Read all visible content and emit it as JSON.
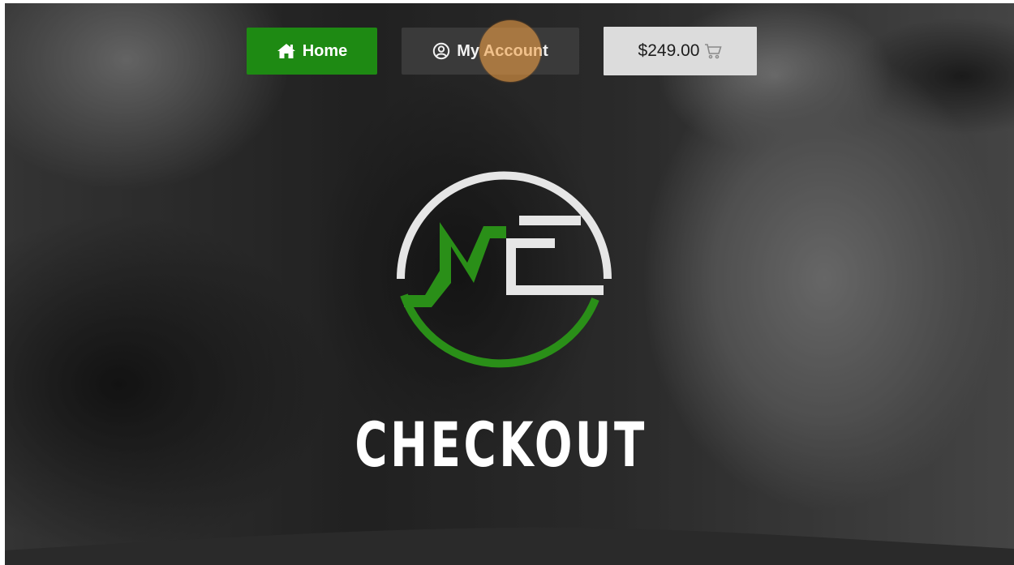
{
  "nav": {
    "home": {
      "label": "Home",
      "icon": "home-icon"
    },
    "account": {
      "label": "My Account",
      "icon": "user-circle-icon"
    },
    "cart": {
      "total": "$249.00",
      "icon": "cart-icon"
    }
  },
  "hero": {
    "title": "CHECKOUT",
    "logo_icon": "me-logo"
  },
  "colors": {
    "brand_green": "#1e8a13",
    "logo_green": "#2a8f18",
    "account_bg": "#3a3a3a",
    "cart_bg": "#dcdcdc",
    "click_marker": "#f0a046"
  }
}
